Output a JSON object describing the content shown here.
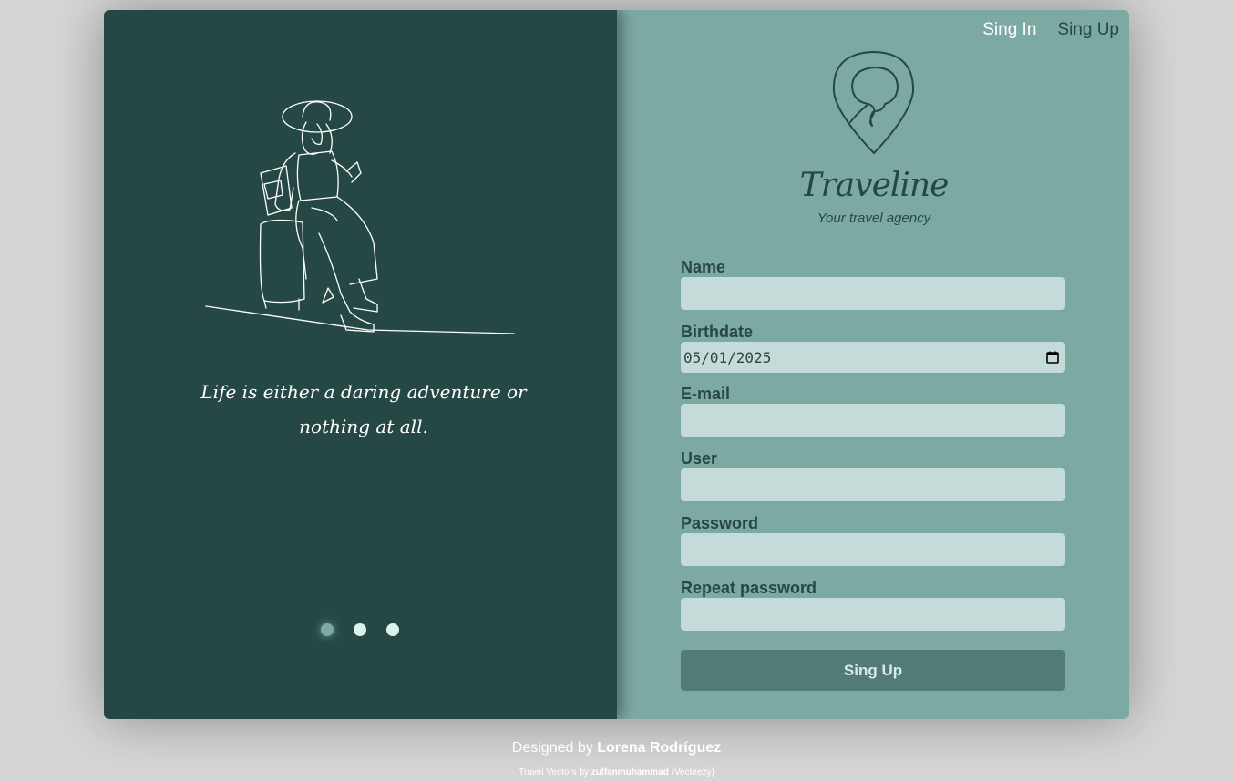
{
  "nav": {
    "signin": "Sing In",
    "signup": "Sing Up"
  },
  "quote": "Life is either a daring adventure or nothing at all.",
  "carousel": {
    "count": 3,
    "active_index": 0
  },
  "brand": {
    "name": "Traveline",
    "tagline": "Your travel agency"
  },
  "form": {
    "name_label": "Name",
    "name_value": "",
    "birthdate_label": "Birthdate",
    "birthdate_value": "05/01/2025",
    "email_label": "E-mail",
    "email_value": "",
    "user_label": "User",
    "user_value": "",
    "password_label": "Password",
    "password_value": "",
    "repeat_password_label": "Repeat password",
    "repeat_password_value": "",
    "submit_label": "Sing Up"
  },
  "footer": {
    "designed_prefix": "Designed by",
    "designer": "Lorena Rodríguez",
    "credit_prefix": "Travel Vectors by",
    "credit_author": "zulfanmuhammad",
    "credit_source": "(Vecteezy)"
  },
  "colors": {
    "dark_panel": "#264845",
    "light_panel": "#7da9a3",
    "input_bg": "#c5dbda",
    "button_bg": "#527a76",
    "page_bg": "#d6d6d6"
  },
  "icons": {
    "logo": "map-pin-icon",
    "date": "calendar-icon"
  }
}
